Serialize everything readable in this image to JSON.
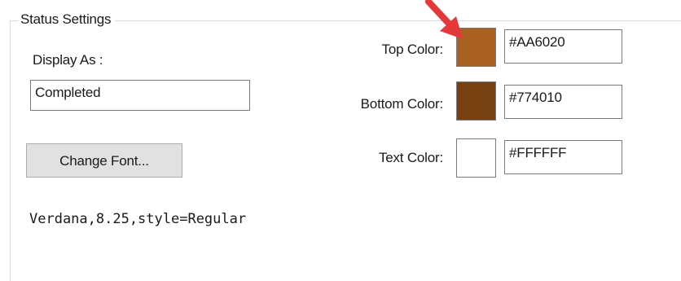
{
  "group": {
    "title": "Status Settings"
  },
  "display_as": {
    "label": "Display As :",
    "value": "Completed"
  },
  "change_font_button": "Change Font...",
  "font_description": "Verdana,8.25,style=Regular",
  "colors": {
    "top": {
      "label": "Top Color:",
      "hex": "#AA6020",
      "swatch": "#AA6020"
    },
    "bottom": {
      "label": "Bottom Color:",
      "hex": "#774010",
      "swatch": "#774010"
    },
    "text": {
      "label": "Text Color:",
      "hex": "#FFFFFF",
      "swatch": "#FFFFFF"
    }
  },
  "annotation": {
    "arrow_color": "#e5383b",
    "points_to": "top-color-swatch"
  }
}
